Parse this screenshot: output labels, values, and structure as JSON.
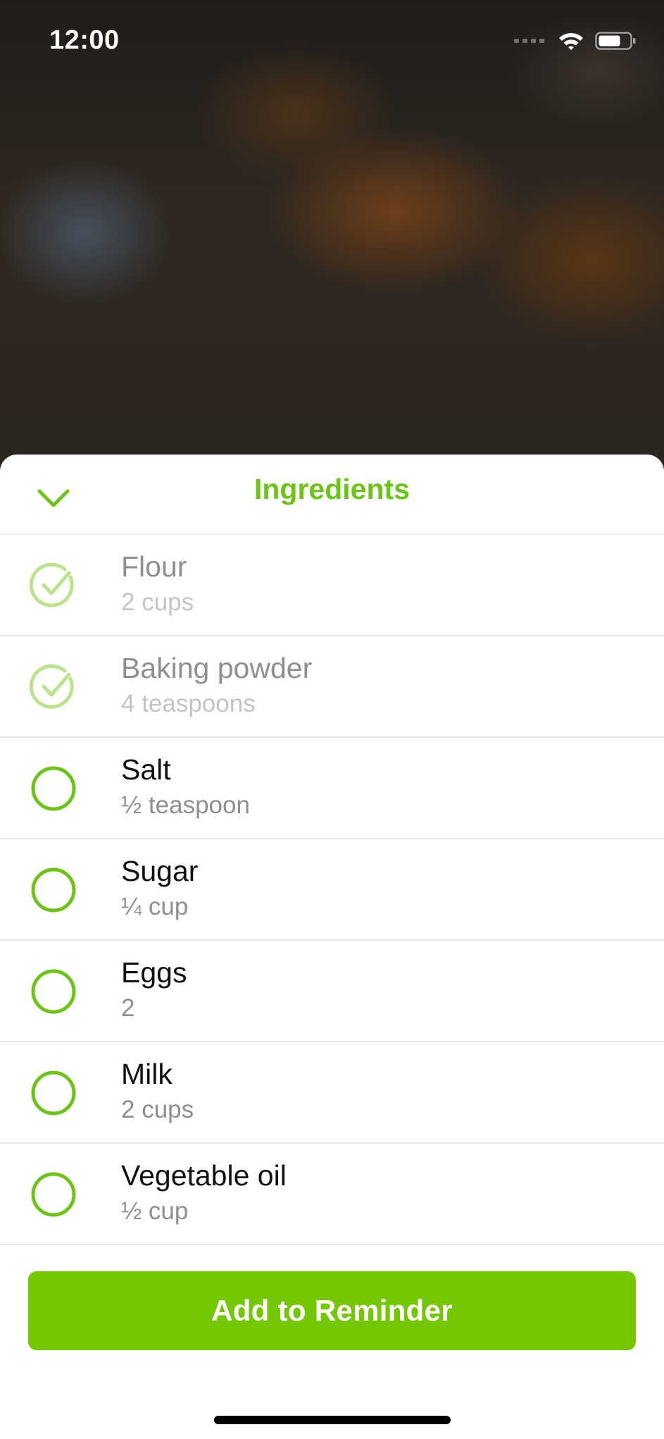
{
  "status_bar": {
    "time": "12:00",
    "icons": [
      "cellular-signal-icon",
      "wifi-icon",
      "battery-icon"
    ]
  },
  "sheet": {
    "title": "Ingredients",
    "collapse_icon": "chevron-down-icon",
    "items": [
      {
        "name": "Flour",
        "quantity": "2 cups",
        "checked": true
      },
      {
        "name": "Baking powder",
        "quantity": "4 teaspoons",
        "checked": true
      },
      {
        "name": "Salt",
        "quantity": "½ teaspoon",
        "checked": false
      },
      {
        "name": "Sugar",
        "quantity": "¼ cup",
        "checked": false
      },
      {
        "name": "Eggs",
        "quantity": "2",
        "checked": false
      },
      {
        "name": "Milk",
        "quantity": "2 cups",
        "checked": false
      },
      {
        "name": "Vegetable oil",
        "quantity": "½ cup",
        "checked": false
      }
    ]
  },
  "action": {
    "label": "Add to Reminder"
  },
  "colors": {
    "accent": "#73c703",
    "accent_text": "#6cc416",
    "checked_faded": "#b9e48a"
  }
}
